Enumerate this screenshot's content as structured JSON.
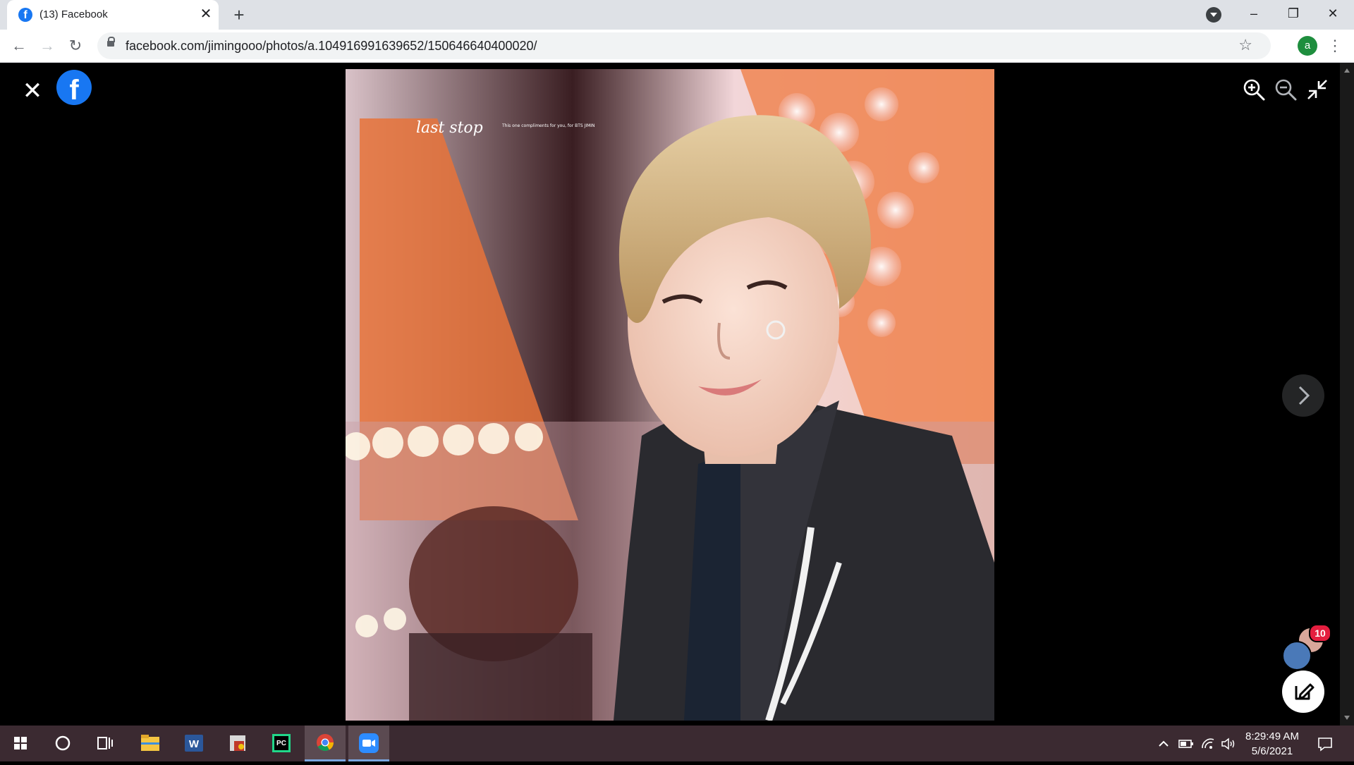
{
  "browser": {
    "tab": {
      "favicon_letter": "f",
      "title": "(13) Facebook",
      "close": "✕"
    },
    "new_tab": "+",
    "window_controls": {
      "minimize": "–",
      "maximize": "❐",
      "close": "✕"
    },
    "nav": {
      "back": "←",
      "forward": "→",
      "reload": "↻"
    },
    "url": "facebook.com/jimingooo/photos/a.104916991639652/150646640400020/",
    "profile_initial": "a",
    "menu": "⋮",
    "star": "☆"
  },
  "viewer": {
    "close": "✕",
    "logo_letter": "f",
    "photo_caption": "last stop",
    "photo_subcaption": "This one compliments for you, for BTS JIMIN",
    "notification_count": "10"
  },
  "taskbar": {
    "time": "8:29:49 AM",
    "date": "5/6/2021",
    "word_letter": "W",
    "pycharm_label": "PC"
  },
  "colors": {
    "facebook_blue": "#1877f2",
    "badge_red": "#e41e3f",
    "taskbar": "#3b2a31"
  },
  "icons": [
    "close-icon",
    "facebook-logo",
    "zoom-in-icon",
    "zoom-out-icon",
    "exit-fullscreen-icon",
    "chevron-right-icon",
    "compose-icon",
    "windows-start-icon",
    "cortana-icon",
    "task-view-icon",
    "file-explorer-icon",
    "word-icon",
    "app-icon",
    "pycharm-icon",
    "chrome-icon",
    "zoom-app-icon",
    "notifications-icon"
  ]
}
